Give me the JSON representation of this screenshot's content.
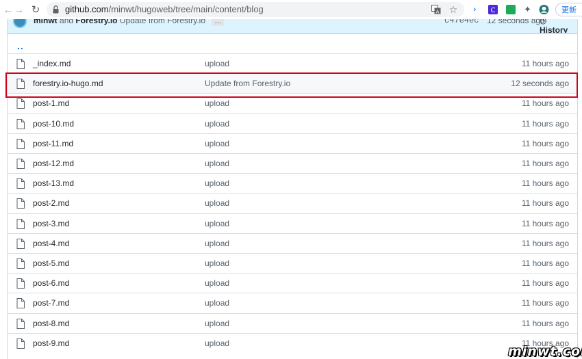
{
  "browser": {
    "url_host": "github.com",
    "url_path": "/minwt/hugoweb/tree/main/content/blog",
    "update_label": "更新"
  },
  "commit": {
    "author": "minwt",
    "conjunction": "and",
    "coauthor": "Forestry.io",
    "message": "Update from Forestry.io",
    "more_label": "…",
    "sha": "c47e4ec",
    "time": "12 seconds ago",
    "history_label": "History"
  },
  "parent_link": "..",
  "files": [
    {
      "name": "_index.md",
      "message": "upload",
      "age": "11 hours ago"
    },
    {
      "name": "forestry.io-hugo.md",
      "message": "Update from Forestry.io",
      "age": "12 seconds ago"
    },
    {
      "name": "post-1.md",
      "message": "upload",
      "age": "11 hours ago"
    },
    {
      "name": "post-10.md",
      "message": "upload",
      "age": "11 hours ago"
    },
    {
      "name": "post-11.md",
      "message": "upload",
      "age": "11 hours ago"
    },
    {
      "name": "post-12.md",
      "message": "upload",
      "age": "11 hours ago"
    },
    {
      "name": "post-13.md",
      "message": "upload",
      "age": "11 hours ago"
    },
    {
      "name": "post-2.md",
      "message": "upload",
      "age": "11 hours ago"
    },
    {
      "name": "post-3.md",
      "message": "upload",
      "age": "11 hours ago"
    },
    {
      "name": "post-4.md",
      "message": "upload",
      "age": "11 hours ago"
    },
    {
      "name": "post-5.md",
      "message": "upload",
      "age": "11 hours ago"
    },
    {
      "name": "post-6.md",
      "message": "upload",
      "age": "11 hours ago"
    },
    {
      "name": "post-7.md",
      "message": "upload",
      "age": "11 hours ago"
    },
    {
      "name": "post-8.md",
      "message": "upload",
      "age": "11 hours ago"
    },
    {
      "name": "post-9.md",
      "message": "upload",
      "age": "11 hours ago"
    }
  ],
  "highlighted_file": "forestry.io-hugo.md",
  "watermark": "minwt.com",
  "colors": {
    "highlight_border": "#d0021b",
    "link": "#0969da",
    "commit_bg": "#ddf4ff"
  }
}
